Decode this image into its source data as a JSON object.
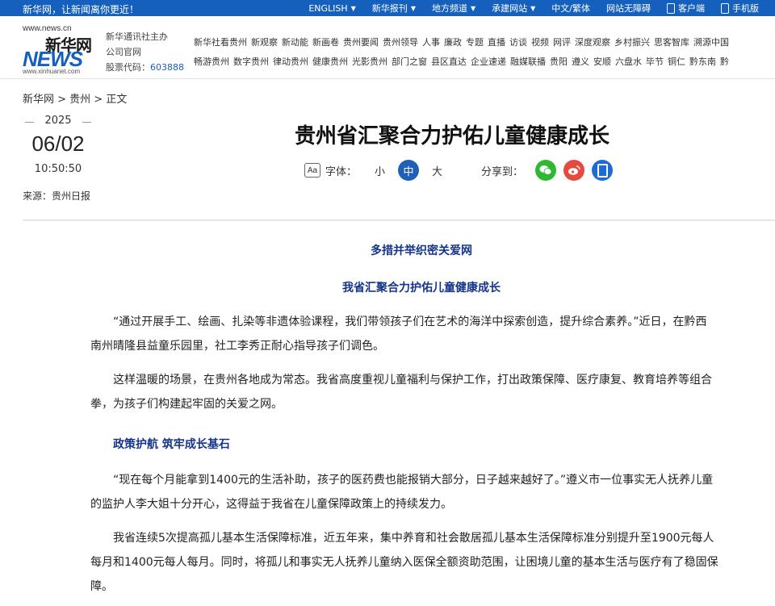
{
  "topbar": {
    "slogan": "新华网，让新闻离你更近！",
    "nav": [
      {
        "label": "ENGLISH",
        "dropdown": true
      },
      {
        "label": "新华报刊",
        "dropdown": true
      },
      {
        "label": "地方频道",
        "dropdown": true
      },
      {
        "label": "承建网站",
        "dropdown": true
      },
      {
        "label": "中文/繁体",
        "dropdown": false
      },
      {
        "label": "网站无障碍",
        "dropdown": false
      },
      {
        "label": "客户端",
        "dropdown": false
      },
      {
        "label": "手机版",
        "dropdown": false
      }
    ]
  },
  "logo": {
    "url": "www.news.cn",
    "cn": "新华网",
    "en": "NEWS",
    "small": "www.xinhuanet.com"
  },
  "org": {
    "line1": "新华通讯社主办",
    "line2": "公司官网",
    "code_label": "股票代码：",
    "code": "603888"
  },
  "channels": {
    "row1": [
      "新华社看贵州",
      "新观察",
      "新动能",
      "新画卷",
      "贵州要闻",
      "贵州领导",
      "人事",
      "廉政",
      "专题",
      "直播",
      "访谈",
      "视频",
      "网评",
      "深度观察",
      "乡村振兴",
      "思客智库",
      "溯源中国"
    ],
    "row2": [
      "畅游贵州",
      "数字贵州",
      "律动贵州",
      "健康贵州",
      "光影贵州",
      "部门之窗",
      "县区直达",
      "企业速递",
      "融媒联播",
      "贵阳",
      "遵义",
      "安顺",
      "六盘水",
      "毕节",
      "铜仁",
      "黔东南",
      "黔"
    ]
  },
  "breadcrumb": "新华网 > 贵州 > 正文",
  "date": {
    "year": "2025",
    "md": "06/02",
    "time": "10:50:50"
  },
  "source": "来源：贵州日报",
  "title": "贵州省汇聚合力护佑儿童健康成长",
  "tools": {
    "font_label": "字体：",
    "small": "小",
    "medium": "中",
    "large": "大",
    "share_label": "分享到："
  },
  "article": {
    "h1": "多措并举织密关爱网",
    "h2": "我省汇聚合力护佑儿童健康成长",
    "p1a": "“通过开展手工、绘画、扎染等非遗体验课程，我们带领孩子们在艺术的海洋中探索创造，提升综合素养。”近日，在黔西",
    "p1b": "南州晴隆县益童乐园里，社工李秀正耐心指导孩子们调色。",
    "p2a": "这样温暖的场景，在贵州各地成为常态。我省高度重视儿童福利与保护工作，打出政策保障、医疗康复、教育培养等组合",
    "p2b": "拳，为孩子们构建起牢固的关爱之网。",
    "sub1": "政策护航 筑牢成长基石",
    "p3a": "“现在每个月能拿到1400元的生活补助，孩子的医药费也能报销大部分，日子越来越好了。”遵义市一位事实无人抚养儿童",
    "p3b": "的监护人李大姐十分开心，这得益于我省在儿童保障政策上的持续发力。",
    "p4a": "我省连续5次提高孤儿基本生活保障标准，近五年来，集中养育和社会散居孤儿基本生活保障标准分别提升至1900元每人",
    "p4b": "每月和1400元每人每月。同时，将孤儿和事实无人抚养儿童纳入医保全额资助范围，让困境儿童的基本生活与医疗有了稳固保",
    "p4c": "障。"
  }
}
